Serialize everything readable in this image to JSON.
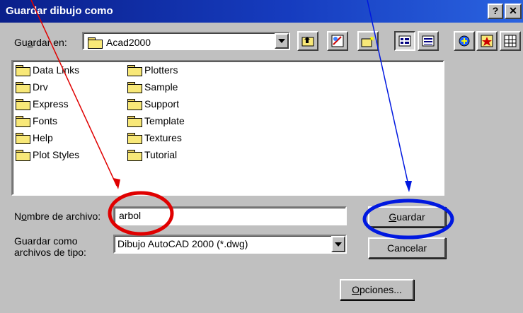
{
  "window": {
    "title": "Guardar dibujo como",
    "help_btn": "?",
    "close_btn": "✕"
  },
  "save_in": {
    "label_pre": "Gu",
    "label_key": "a",
    "label_post": "rdar en:",
    "value": "Acad2000"
  },
  "toolbar": {
    "icons": [
      "up-folder-icon",
      "autocad-find-icon",
      "new-folder-icon",
      "list-view-icon",
      "details-view-icon",
      "locate-icon",
      "favorites-icon",
      "grid-options-icon"
    ]
  },
  "folders": {
    "col1": [
      "Data Links",
      "Drv",
      "Express",
      "Fonts",
      "Help",
      "Plot Styles"
    ],
    "col2": [
      "Plotters",
      "Sample",
      "Support",
      "Template",
      "Textures",
      "Tutorial"
    ]
  },
  "filename": {
    "label_pre": "N",
    "label_key": "o",
    "label_post": "mbre de archivo:",
    "value": "arbol"
  },
  "filetype": {
    "label_line1": "Guardar como",
    "label_line2": "archivos de tipo:",
    "value": "Dibujo AutoCAD 2000 (*.dwg)"
  },
  "buttons": {
    "save_key": "G",
    "save_rest": "uardar",
    "cancel": "Cancelar",
    "options_key": "O",
    "options_rest": "pciones..."
  },
  "annotations": {
    "red_color": "#e00000",
    "blue_color": "#0018e0"
  }
}
